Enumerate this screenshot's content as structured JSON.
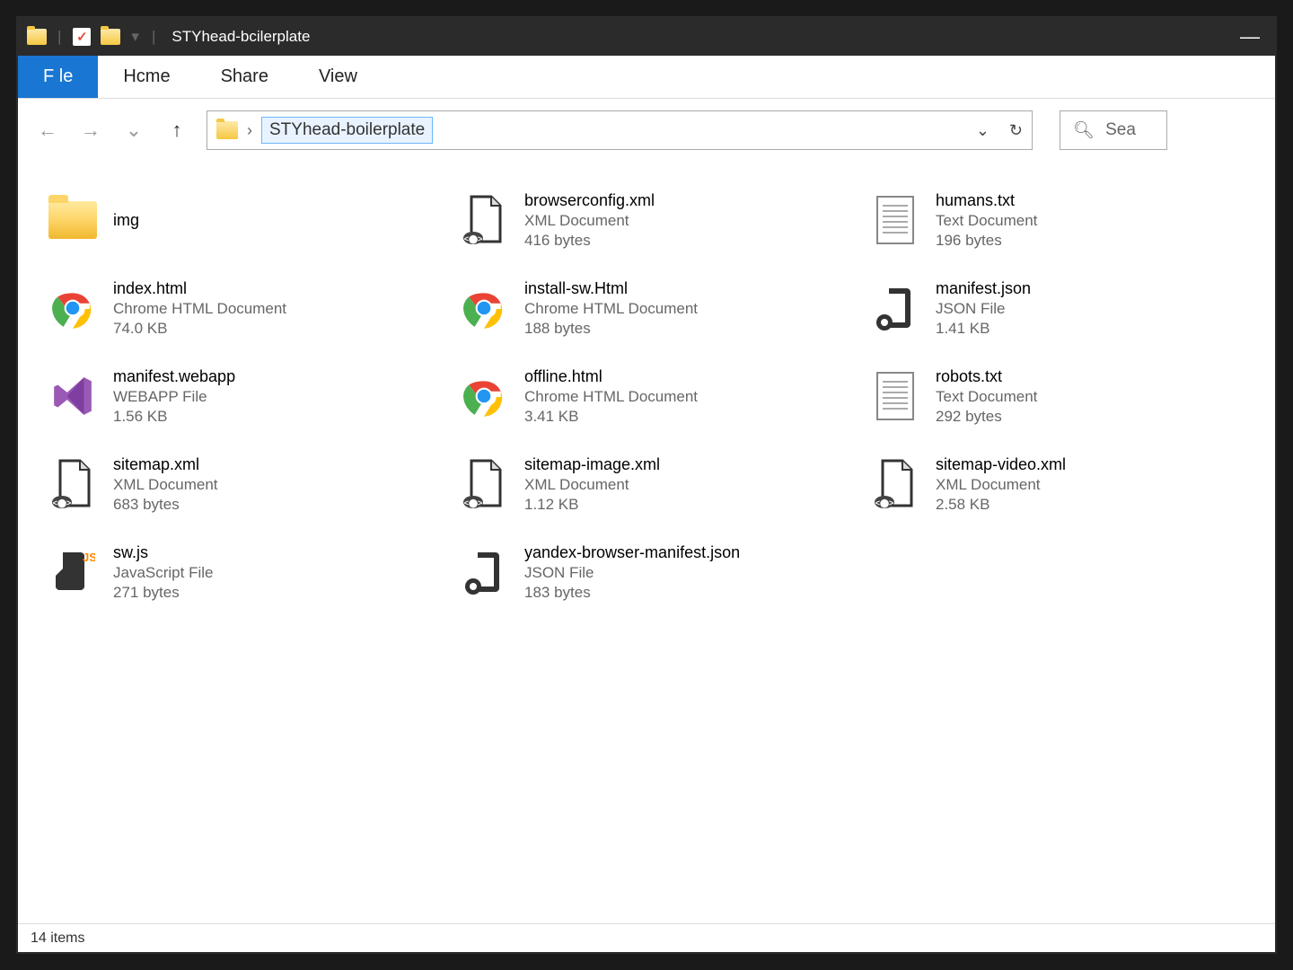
{
  "titlebar": {
    "title": "STYhead-bcilerplate"
  },
  "ribbon": {
    "file": "F le",
    "home": "Hcme",
    "share": "Share",
    "view": "View"
  },
  "address": {
    "path": "STYhead-boilerplate"
  },
  "search": {
    "placeholder": "Sea"
  },
  "statusbar": {
    "count": "14 items"
  },
  "files": [
    {
      "name": "img",
      "type": "",
      "size": "",
      "icon": "folder"
    },
    {
      "name": "browserconfig.xml",
      "type": "XML Document",
      "size": "416 bytes",
      "icon": "xml"
    },
    {
      "name": "humans.txt",
      "type": "Text Document",
      "size": "196 bytes",
      "icon": "txt"
    },
    {
      "name": "index.html",
      "type": "Chrome HTML Document",
      "size": "74.0 KB",
      "icon": "chrome"
    },
    {
      "name": "install-sw.Html",
      "type": "Chrome HTML Document",
      "size": "188 bytes",
      "icon": "chrome"
    },
    {
      "name": "manifest.json",
      "type": "JSON File",
      "size": "1.41 KB",
      "icon": "json"
    },
    {
      "name": "manifest.webapp",
      "type": "WEBAPP File",
      "size": "1.56 KB",
      "icon": "vs"
    },
    {
      "name": "offline.html",
      "type": "Chrome HTML Document",
      "size": "3.41 KB",
      "icon": "chrome"
    },
    {
      "name": "robots.txt",
      "type": "Text Document",
      "size": "292 bytes",
      "icon": "txt"
    },
    {
      "name": "sitemap.xml",
      "type": "XML Document",
      "size": "683 bytes",
      "icon": "xml"
    },
    {
      "name": "sitemap-image.xml",
      "type": "XML Document",
      "size": "1.12 KB",
      "icon": "xml"
    },
    {
      "name": "sitemap-video.xml",
      "type": "XML Document",
      "size": "2.58 KB",
      "icon": "xml"
    },
    {
      "name": "sw.js",
      "type": "JavaScript File",
      "size": "271 bytes",
      "icon": "js"
    },
    {
      "name": "yandex-browser-manifest.json",
      "type": "JSON File",
      "size": "183 bytes",
      "icon": "json"
    }
  ]
}
